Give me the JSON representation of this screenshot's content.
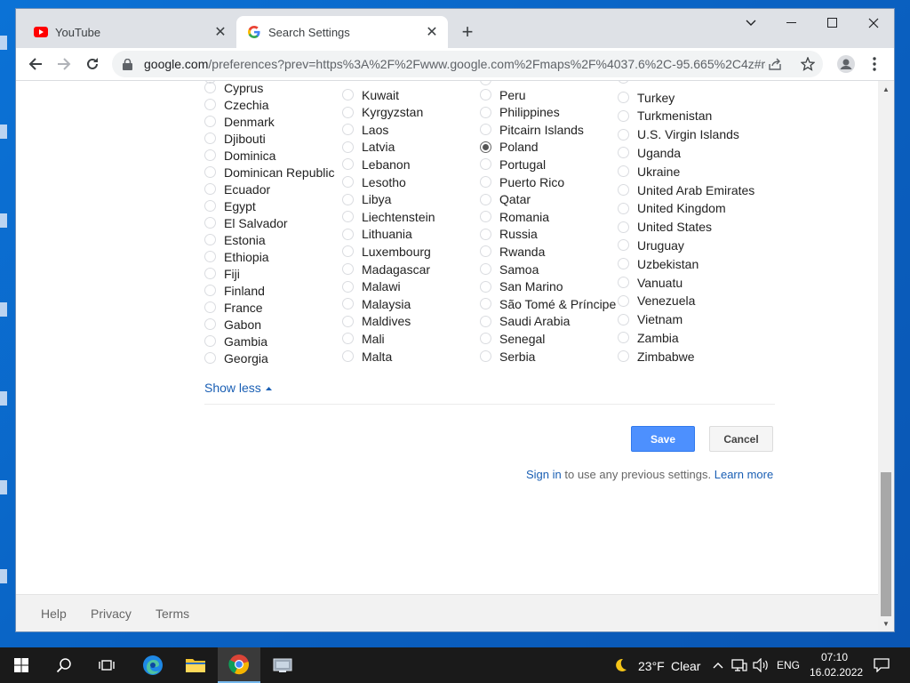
{
  "browser": {
    "tabs": [
      {
        "label": "YouTube",
        "favicon": "youtube-icon",
        "active": false
      },
      {
        "label": "Search Settings",
        "favicon": "google-icon",
        "active": true
      }
    ],
    "address": {
      "host": "google.com",
      "path": "/preferences?prev=https%3A%2F%2Fwww.google.com%2Fmaps%2F%4037.6%2C-95.665%2C4z#re..."
    }
  },
  "regions": {
    "col1": [
      "Cyprus",
      "Czechia",
      "Denmark",
      "Djibouti",
      "Dominica",
      "Dominican Republic",
      "Ecuador",
      "Egypt",
      "El Salvador",
      "Estonia",
      "Ethiopia",
      "Fiji",
      "Finland",
      "France",
      "Gabon",
      "Gambia",
      "Georgia"
    ],
    "col2": [
      "Kuwait",
      "Kyrgyzstan",
      "Laos",
      "Latvia",
      "Lebanon",
      "Lesotho",
      "Libya",
      "Liechtenstein",
      "Lithuania",
      "Luxembourg",
      "Madagascar",
      "Malawi",
      "Malaysia",
      "Maldives",
      "Mali",
      "Malta"
    ],
    "col3": [
      "Peru",
      "Philippines",
      "Pitcairn Islands",
      "Poland",
      "Portugal",
      "Puerto Rico",
      "Qatar",
      "Romania",
      "Russia",
      "Rwanda",
      "Samoa",
      "San Marino",
      "São Tomé & Príncipe",
      "Saudi Arabia",
      "Senegal",
      "Serbia"
    ],
    "col4": [
      "Turkey",
      "Turkmenistan",
      "U.S. Virgin Islands",
      "Uganda",
      "Ukraine",
      "United Arab Emirates",
      "United Kingdom",
      "United States",
      "Uruguay",
      "Uzbekistan",
      "Vanuatu",
      "Venezuela",
      "Vietnam",
      "Zambia",
      "Zimbabwe"
    ],
    "selected": "Poland",
    "show_less": "Show less"
  },
  "actions": {
    "save": "Save",
    "cancel": "Cancel",
    "signin": "Sign in",
    "signin_rest": " to use any previous settings. ",
    "learn_more": "Learn more"
  },
  "footer": {
    "help": "Help",
    "privacy": "Privacy",
    "terms": "Terms"
  },
  "taskbar": {
    "weather_temp": "23°F",
    "weather_cond": "Clear",
    "lang": "ENG",
    "time": "07:10",
    "date": "16.02.2022"
  },
  "colors": {
    "accent": "#4d90fe",
    "link": "#1a5fb4"
  }
}
